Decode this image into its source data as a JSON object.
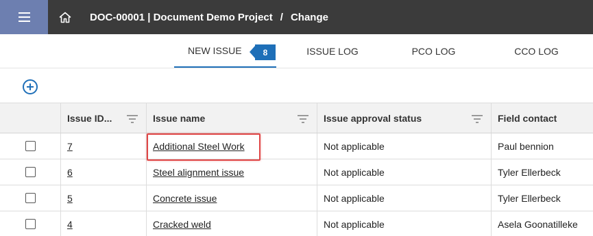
{
  "header": {
    "breadcrumb_project": "DOC-00001 | Document Demo Project",
    "breadcrumb_separator": "/",
    "breadcrumb_current": "Change",
    "menu_icon": "hamburger-menu-icon",
    "home_icon": "home-icon",
    "menu_bg_color": "#6d7fb0",
    "bar_color": "#3b3b3b"
  },
  "tabs": [
    {
      "label": "NEW ISSUE",
      "badge": "8",
      "active": true
    },
    {
      "label": "ISSUE LOG"
    },
    {
      "label": "PCO LOG"
    },
    {
      "label": "CCO LOG"
    }
  ],
  "toolbar": {
    "add_icon": "add-circle-icon",
    "accent_color": "#1e6fb8"
  },
  "table": {
    "columns": [
      "Issue ID...",
      "Issue name",
      "Issue approval status",
      "Field contact"
    ],
    "rows": [
      {
        "id": "7",
        "name": "Additional Steel Work",
        "status": "Not applicable",
        "contact": "Paul bennion"
      },
      {
        "id": "6",
        "name": "Steel alignment issue",
        "status": "Not applicable",
        "contact": "Tyler Ellerbeck"
      },
      {
        "id": "5",
        "name": "Concrete issue",
        "status": "Not applicable",
        "contact": "Tyler Ellerbeck"
      },
      {
        "id": "4",
        "name": "Cracked weld",
        "status": "Not applicable",
        "contact": "Asela Goonatilleke"
      }
    ],
    "highlight_color": "#e04545"
  }
}
